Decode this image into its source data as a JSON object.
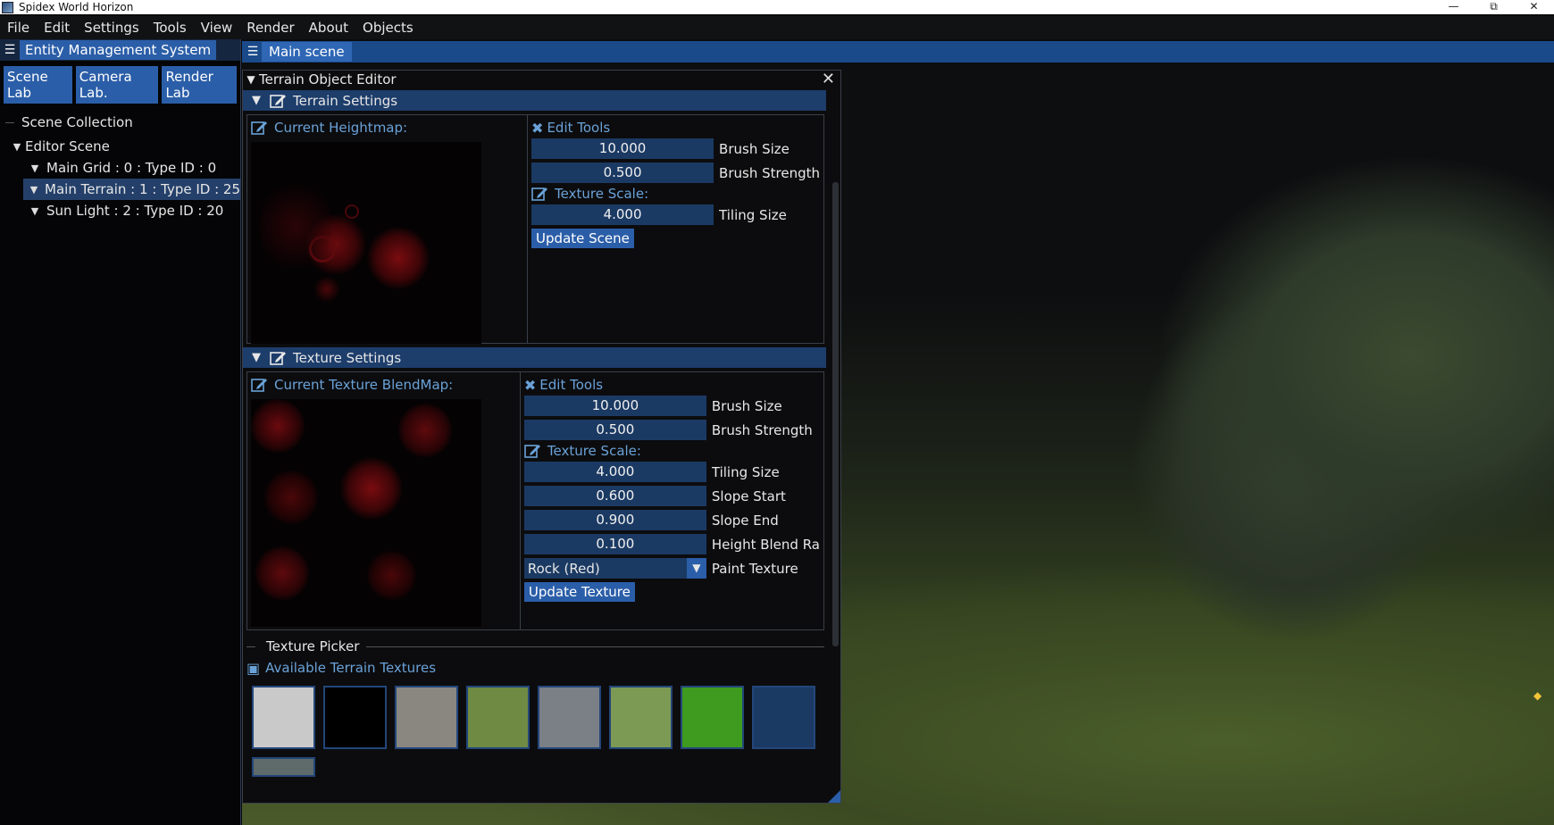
{
  "window": {
    "title": "Spidex World Horizon",
    "controls": [
      "—",
      "⧉",
      "✕"
    ]
  },
  "menu": [
    "File",
    "Edit",
    "Settings",
    "Tools",
    "View",
    "Render",
    "About",
    "Objects"
  ],
  "left_panel": {
    "title": "Entity Management System",
    "tabs": [
      "Scene Lab",
      "Camera Lab.",
      "Render Lab"
    ],
    "collection_label": "Scene Collection",
    "tree_root": "Editor Scene",
    "tree_items": [
      "Main Grid : 0 : Type ID : 0",
      "Main Terrain : 1 : Type ID : 25",
      "Sun Light : 2 : Type ID : 20"
    ]
  },
  "main": {
    "tab_title": "Main scene"
  },
  "editor": {
    "title": "Terrain Object Editor",
    "terrain": {
      "header": "Terrain Settings",
      "map_label": "Current Heightmap:",
      "tools_label": "Edit Tools",
      "brush_size": "10.000",
      "brush_size_label": "Brush Size",
      "brush_strength": "0.500",
      "brush_strength_label": "Brush Strength",
      "texture_scale_label": "Texture Scale:",
      "tiling_size": "4.000",
      "tiling_size_label": "Tiling Size",
      "update_button": "Update Scene"
    },
    "texture": {
      "header": "Texture Settings",
      "map_label": "Current Texture BlendMap:",
      "tools_label": "Edit Tools",
      "brush_size": "10.000",
      "brush_size_label": "Brush Size",
      "brush_strength": "0.500",
      "brush_strength_label": "Brush Strength",
      "texture_scale_label": "Texture Scale:",
      "tiling_size": "4.000",
      "tiling_size_label": "Tiling Size",
      "slope_start": "0.600",
      "slope_start_label": "Slope Start",
      "slope_end": "0.900",
      "slope_end_label": "Slope End",
      "height_blend": "0.100",
      "height_blend_label": "Height Blend Ra",
      "paint_texture_value": "Rock (Red)",
      "paint_texture_label": "Paint Texture",
      "update_button": "Update Texture"
    },
    "picker": {
      "title": "Texture Picker",
      "available_label": "Available Terrain Textures",
      "swatches": [
        "#c9c9c9",
        "#000000",
        "#8a8680",
        "#6f8a43",
        "#7b7f86",
        "#7d9a55",
        "#3f9b20",
        "#1b3a63",
        "#5f6a6a"
      ]
    }
  },
  "colors": {
    "accent": "#2b5ea8",
    "header": "#1d3d6b",
    "field": "#1b3a63",
    "label_blue": "#6aa2d8"
  }
}
